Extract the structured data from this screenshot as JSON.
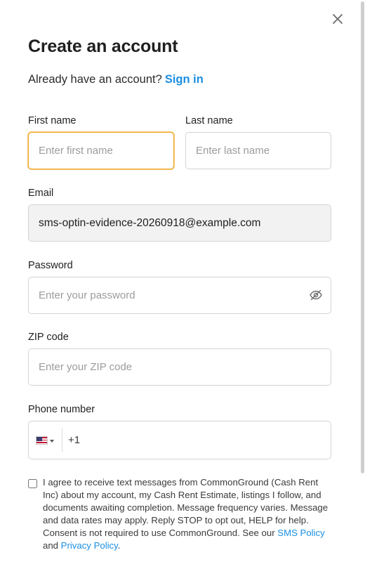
{
  "modal": {
    "title": "Create an account",
    "signin_prompt": "Already have an account?",
    "signin_link": "Sign in"
  },
  "form": {
    "first_name": {
      "label": "First name",
      "placeholder": "Enter first name",
      "value": ""
    },
    "last_name": {
      "label": "Last name",
      "placeholder": "Enter last name",
      "value": ""
    },
    "email": {
      "label": "Email",
      "value": "sms-optin-evidence-20260918@example.com"
    },
    "password": {
      "label": "Password",
      "placeholder": "Enter your password",
      "value": ""
    },
    "zip": {
      "label": "ZIP code",
      "placeholder": "Enter your ZIP code",
      "value": ""
    },
    "phone": {
      "label": "Phone number",
      "country": "us-flag-icon",
      "dial_code": "+1",
      "value": ""
    }
  },
  "consent": {
    "checked": false,
    "text_before": "I agree to receive text messages from CommonGround (Cash Rent Inc) about my account, my Cash Rent Estimate, listings I follow, and documents awaiting completion. Message frequency varies. Message and data rates may apply. Reply STOP to opt out, HELP for help. Consent is not required to use CommonGround. See our ",
    "sms_policy_link": "SMS Policy",
    "and": " and ",
    "privacy_policy_link": "Privacy Policy",
    "end": "."
  },
  "colors": {
    "accent": "#1a8fe3",
    "focus_border": "#f0a830",
    "readonly_bg": "#f2f2f2"
  }
}
